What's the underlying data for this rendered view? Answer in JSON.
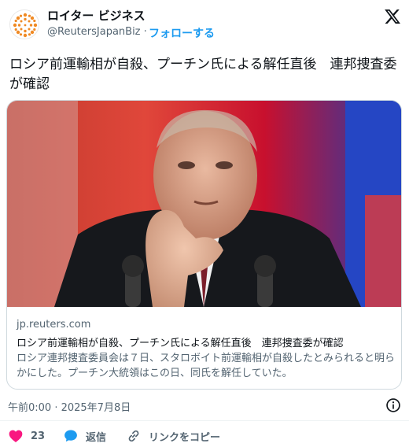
{
  "author": {
    "name": "ロイター ビジネス",
    "handle": "@ReutersJapanBiz",
    "separator": "·",
    "follow_label": "フォローする"
  },
  "tweet": {
    "text": "ロシア前運輸相が自殺、プーチン氏による解任直後　連邦捜査委が確認"
  },
  "card": {
    "domain": "jp.reuters.com",
    "title": "ロシア前運輸相が自殺、プーチン氏による解任直後　連邦捜査委が確認",
    "description": "ロシア連邦捜査委員会は７日、スタロボイト前運輸相が自殺したとみられると明らかにした。プーチン大統領はこの日、同氏を解任していた。"
  },
  "meta": {
    "timestamp": "午前0:00 · 2025年7月8日"
  },
  "actions": {
    "like_count": "23",
    "reply_label": "返信",
    "copy_link_label": "リンクをコピー"
  },
  "colors": {
    "accent": "#1d9bf0",
    "like": "#f91880",
    "text": "#0f1419",
    "muted": "#536471",
    "brand_orange": "#f08a24"
  },
  "icons": {
    "avatar": "reuters-logo-icon",
    "platform": "x-logo-icon",
    "info": "info-icon",
    "like": "heart-icon",
    "reply": "reply-bubble-icon",
    "copy": "link-icon"
  }
}
